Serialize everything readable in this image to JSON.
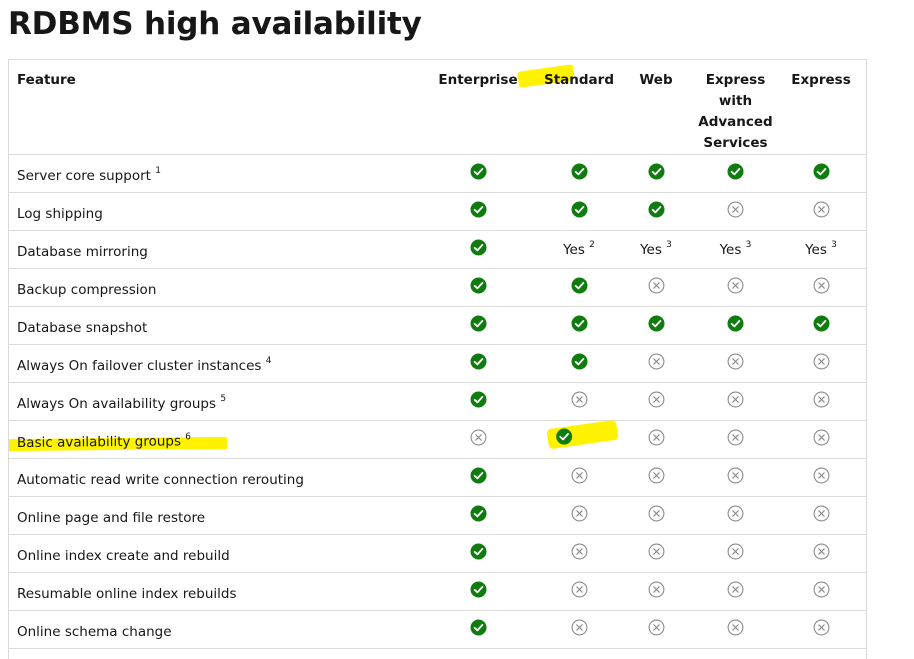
{
  "title": "RDBMS high availability",
  "columns": [
    "Feature",
    "Enterprise",
    "Standard",
    "Web",
    "Express with Advanced Services",
    "Express"
  ],
  "columns_multiline": {
    "express_adv": [
      "Express",
      "with",
      "Advanced",
      "Services"
    ]
  },
  "highlighted_column": "Standard",
  "highlighted_row": "Basic availability groups",
  "rows": [
    {
      "feature": "Server core support",
      "sup": "1",
      "cells": [
        "yes",
        "yes",
        "yes",
        "yes",
        "yes"
      ]
    },
    {
      "feature": "Log shipping",
      "sup": "",
      "cells": [
        "yes",
        "yes",
        "yes",
        "no",
        "no"
      ]
    },
    {
      "feature": "Database mirroring",
      "sup": "",
      "cells": [
        "yes",
        {
          "text": "Yes",
          "sup": "2"
        },
        {
          "text": "Yes",
          "sup": "3"
        },
        {
          "text": "Yes",
          "sup": "3"
        },
        {
          "text": "Yes",
          "sup": "3"
        }
      ]
    },
    {
      "feature": "Backup compression",
      "sup": "",
      "cells": [
        "yes",
        "yes",
        "no",
        "no",
        "no"
      ]
    },
    {
      "feature": "Database snapshot",
      "sup": "",
      "cells": [
        "yes",
        "yes",
        "yes",
        "yes",
        "yes"
      ]
    },
    {
      "feature": "Always On failover cluster instances",
      "sup": "4",
      "cells": [
        "yes",
        "yes",
        "no",
        "no",
        "no"
      ]
    },
    {
      "feature": "Always On availability groups",
      "sup": "5",
      "cells": [
        "yes",
        "no",
        "no",
        "no",
        "no"
      ]
    },
    {
      "feature": "Basic availability groups",
      "sup": "6",
      "cells": [
        "no",
        "yes",
        "no",
        "no",
        "no"
      ]
    },
    {
      "feature": "Automatic read write connection rerouting",
      "sup": "",
      "cells": [
        "yes",
        "no",
        "no",
        "no",
        "no"
      ]
    },
    {
      "feature": "Online page and file restore",
      "sup": "",
      "cells": [
        "yes",
        "no",
        "no",
        "no",
        "no"
      ]
    },
    {
      "feature": "Online index create and rebuild",
      "sup": "",
      "cells": [
        "yes",
        "no",
        "no",
        "no",
        "no"
      ]
    },
    {
      "feature": "Resumable online index rebuilds",
      "sup": "",
      "cells": [
        "yes",
        "no",
        "no",
        "no",
        "no"
      ]
    },
    {
      "feature": "Online schema change",
      "sup": "",
      "cells": [
        "yes",
        "no",
        "no",
        "no",
        "no"
      ]
    }
  ],
  "colors": {
    "check": "#107c10",
    "cross": "#8a8a8a",
    "highlight": "#fff200"
  },
  "icons": {
    "yes": "check-circle-icon",
    "no": "x-circle-icon"
  }
}
